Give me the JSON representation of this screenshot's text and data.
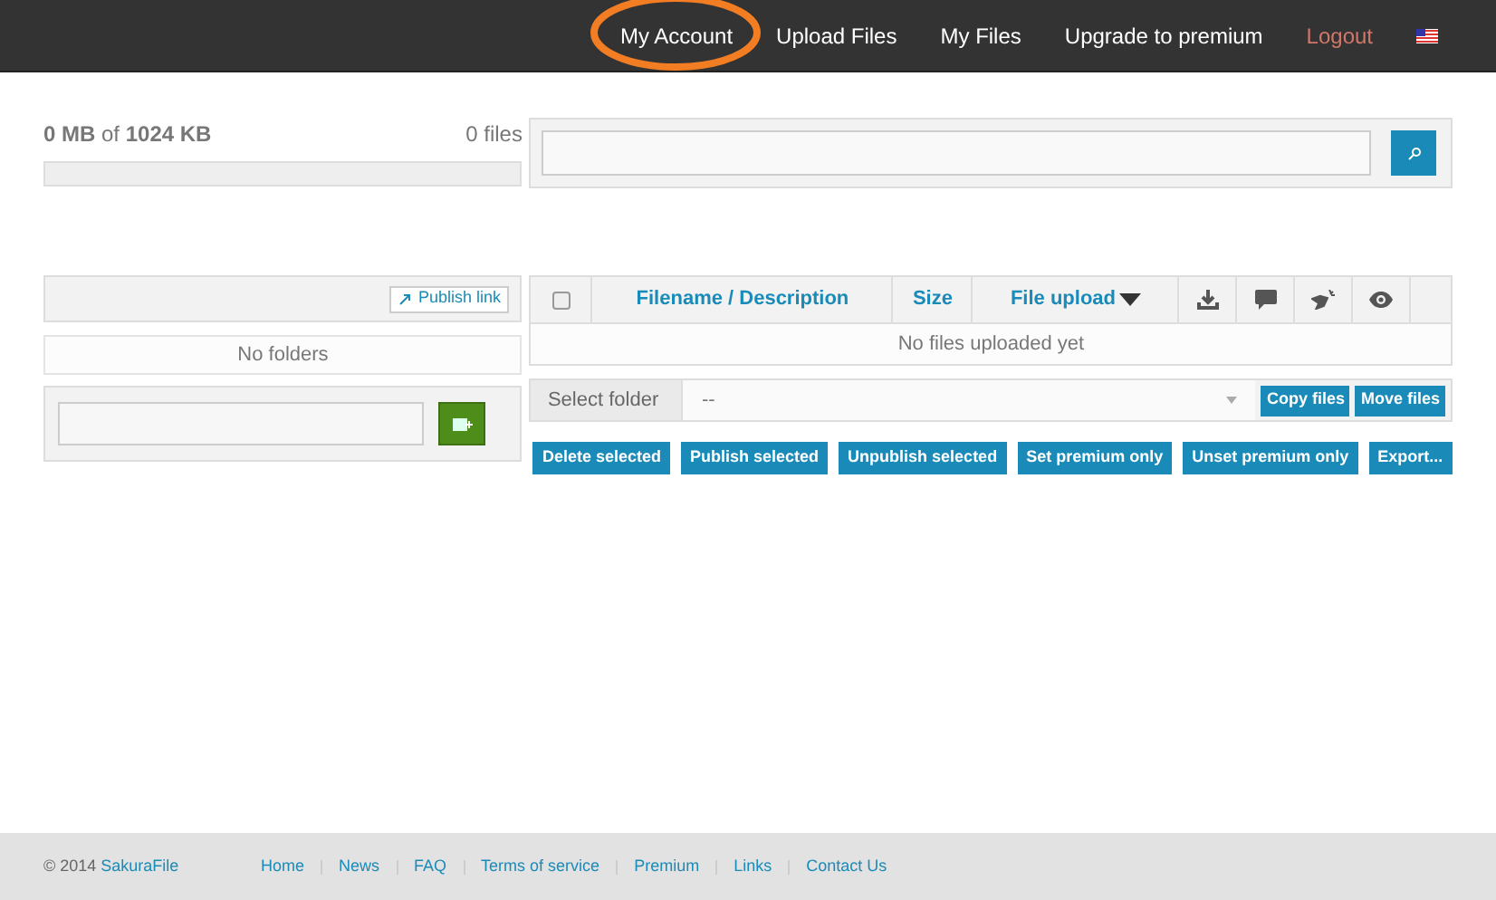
{
  "nav": {
    "items": [
      {
        "label": "My Account",
        "kind": "link",
        "circled": true
      },
      {
        "label": "Upload Files",
        "kind": "link"
      },
      {
        "label": "My Files",
        "kind": "link"
      },
      {
        "label": "Upgrade to premium",
        "kind": "link"
      },
      {
        "label": "Logout",
        "kind": "logout"
      },
      {
        "kind": "flag"
      }
    ]
  },
  "storage": {
    "usage": "**0 MB** of **1024 KB**",
    "files": "0 files",
    "level": 0
  },
  "folders": {
    "publish_link": "Publish link",
    "empty": "No folders"
  },
  "table": {
    "select_all": {
      "checked": false
    },
    "columns": [
      {
        "kind": "text",
        "label": "Filename / Description"
      },
      {
        "kind": "text",
        "label": "Size"
      },
      {
        "kind": "sort",
        "label": "File upload"
      },
      {
        "kind": "download"
      },
      {
        "kind": "comment"
      },
      {
        "kind": "tag"
      },
      {
        "kind": "eye"
      }
    ],
    "empty": "No files uploaded yet"
  },
  "move": {
    "label": "Select folder",
    "value": "--",
    "buttons": [
      "Copy files",
      "Move files"
    ]
  },
  "actions": [
    "Delete selected",
    "Publish selected",
    "Unpublish selected",
    "Set premium only",
    "Unset premium only",
    "Export..."
  ],
  "footer": {
    "copyright": "© 2014",
    "brand": "SakuraFile",
    "links": [
      "Home",
      "News",
      "FAQ",
      "Terms of service",
      "Premium",
      "Links",
      "Contact Us"
    ]
  }
}
